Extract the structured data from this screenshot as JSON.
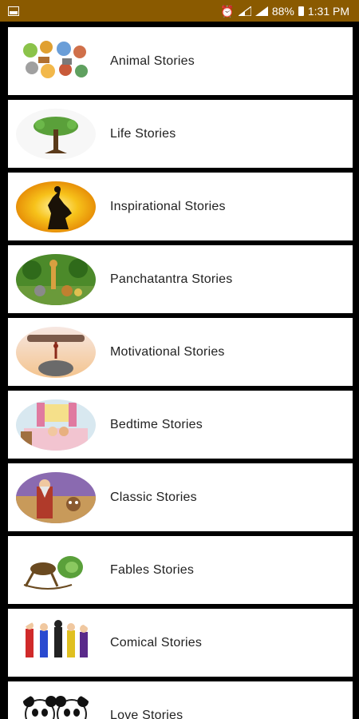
{
  "status_bar": {
    "battery": "88%",
    "time": "1:31 PM",
    "icons": [
      "photo-icon",
      "alarm-icon",
      "signal-icon",
      "signal-icon",
      "battery-icon"
    ]
  },
  "stories": [
    {
      "label": "Animal Stories",
      "icon": "animals-thumbnail"
    },
    {
      "label": "Life Stories",
      "icon": "tree-thumbnail"
    },
    {
      "label": "Inspirational Stories",
      "icon": "sunset-silhouette-thumbnail"
    },
    {
      "label": "Panchatantra Stories",
      "icon": "jungle-animals-thumbnail"
    },
    {
      "label": "Motivational Stories",
      "icon": "ant-lifting-log-thumbnail"
    },
    {
      "label": "Bedtime Stories",
      "icon": "bedroom-thumbnail"
    },
    {
      "label": "Classic Stories",
      "icon": "old-man-thumbnail"
    },
    {
      "label": "Fables Stories",
      "icon": "grasshopper-thumbnail"
    },
    {
      "label": "Comical Stories",
      "icon": "superheroes-thumbnail"
    },
    {
      "label": "Love Stories",
      "icon": "pandas-thumbnail"
    }
  ]
}
